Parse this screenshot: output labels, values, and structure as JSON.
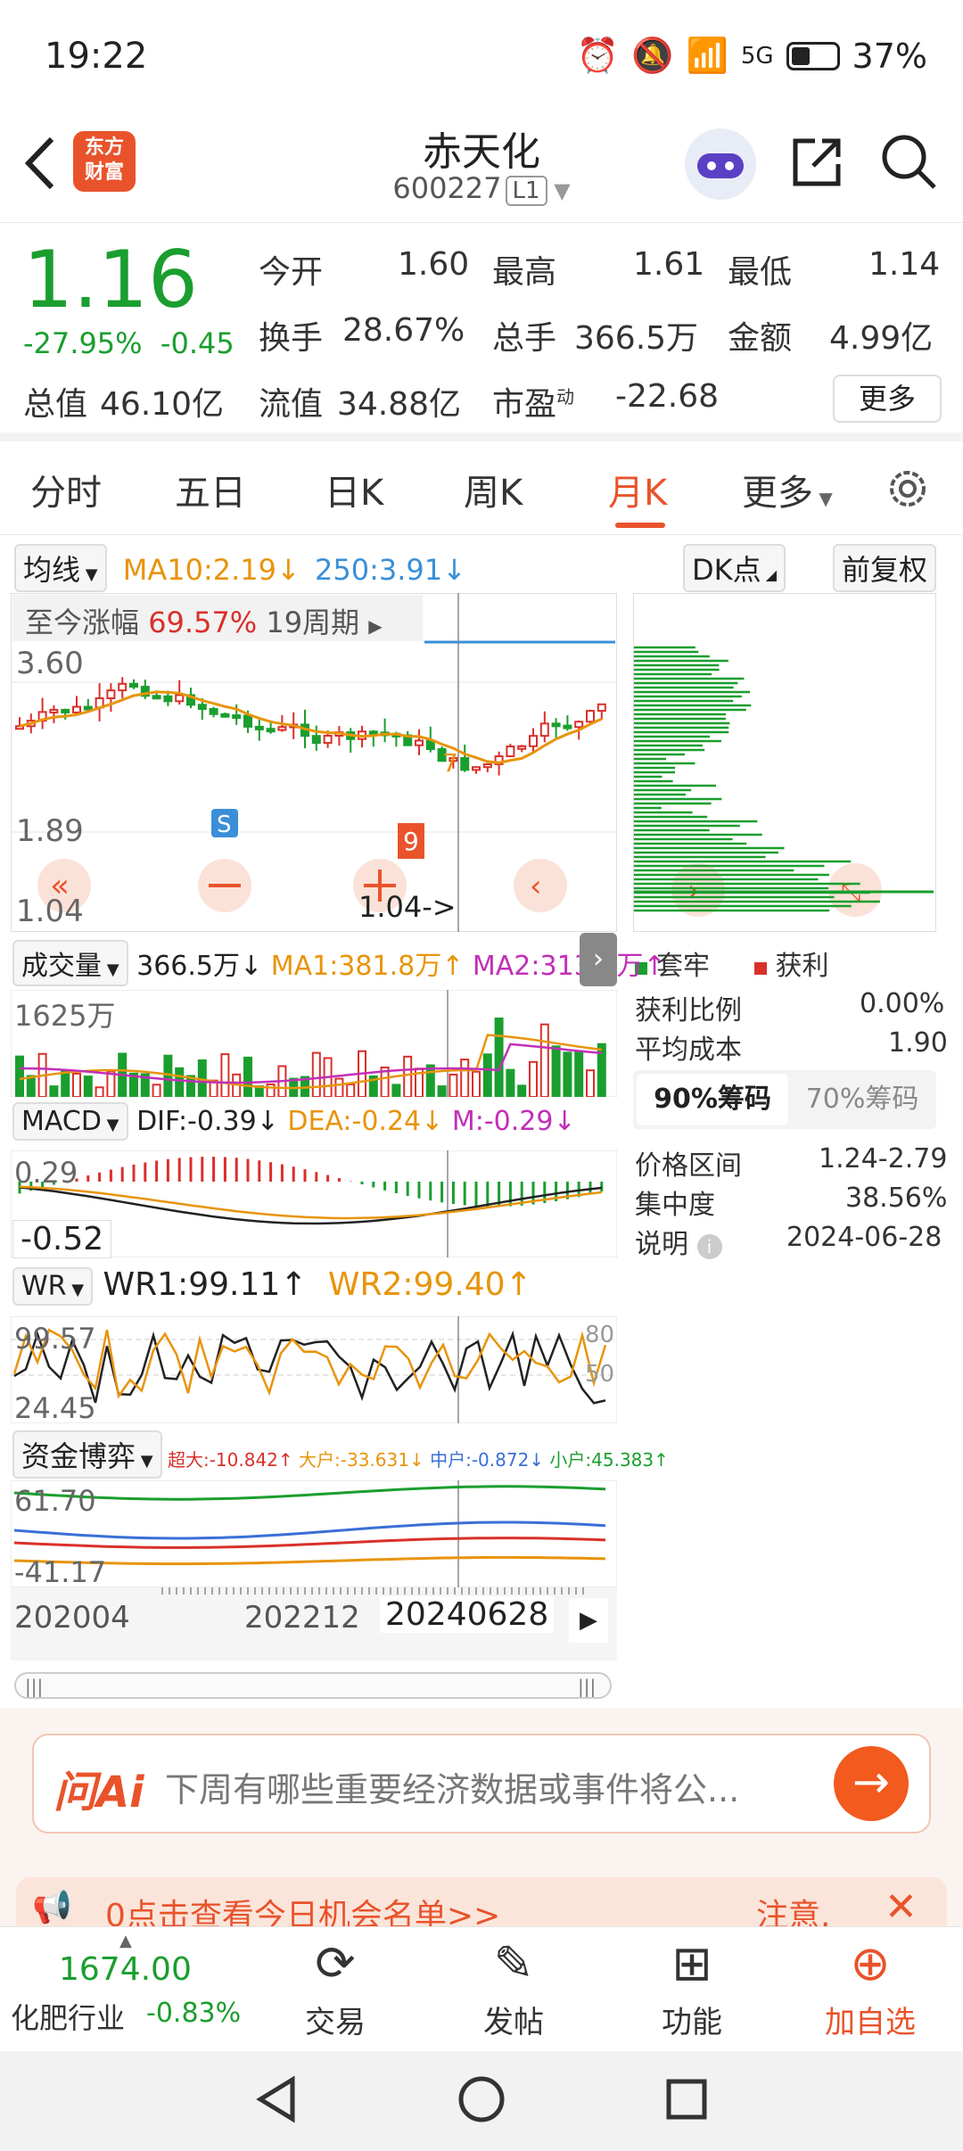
{
  "status": {
    "time": "19:22",
    "battery": "37%",
    "network": "5G"
  },
  "header": {
    "logo": "东方财富",
    "title": "赤天化",
    "code": "600227",
    "level": "L1"
  },
  "quote": {
    "price": "1.16",
    "pct": "-27.95%",
    "chg": "-0.45",
    "open_label": "今开",
    "open": "1.60",
    "high_label": "最高",
    "high": "1.61",
    "low_label": "最低",
    "low": "1.14",
    "turnover_label": "换手",
    "turnover": "28.67%",
    "volume_label": "总手",
    "volume": "366.5万",
    "amount_label": "金额",
    "amount": "4.99亿",
    "mktcap_label": "总值",
    "mktcap": "46.10亿",
    "float_label": "流值",
    "float": "34.88亿",
    "pe_label": "市盈",
    "pe_sup": "动",
    "pe": "-22.68",
    "more": "更多"
  },
  "tabs": [
    "分时",
    "五日",
    "日K",
    "周K",
    "月K",
    "更多"
  ],
  "active_tab": "月K",
  "ma": {
    "label": "均线",
    "ma10": "MA10:2.19↓",
    "ma250": "250:3.91↓",
    "dk": "DK点",
    "adjust": "前复权"
  },
  "main_chart": {
    "since": "至今涨幅",
    "since_pct": "69.57%",
    "periods": "19周期",
    "y_top": "3.60",
    "y_mid": "1.89",
    "y_bottom": "1.04",
    "low_marker": "1.04->",
    "signal_s": "S",
    "signal_nine": "9",
    "signal_seven": "7"
  },
  "volume": {
    "label": "成交量",
    "value": "366.5万↓",
    "ma1": "MA1:381.8万↑",
    "ma2": "MA2:313.2万↑",
    "y_top": "1625万"
  },
  "macd": {
    "label": "MACD",
    "dif": "DIF:-0.39↓",
    "dea": "DEA:-0.24↓",
    "m": "M:-0.29↓",
    "y_top": "0.29",
    "y_bottom": "-0.52"
  },
  "wr": {
    "label": "WR",
    "wr1": "WR1:99.11↑",
    "wr2": "WR2:99.40↑",
    "y_top": "99.57",
    "y_bottom": "24.45",
    "r80": "80",
    "r50": "50"
  },
  "fund": {
    "label": "资金博弈",
    "super": "超大:-10.842↑",
    "big": "大户:-33.631↓",
    "mid": "中户:-0.872↓",
    "small": "小户:45.383↑",
    "y_top": "61.70",
    "y_bottom": "-41.17"
  },
  "x_axis": {
    "start": "202004",
    "mid": "202212",
    "cursor": "20240628"
  },
  "chips": {
    "legend_trapped": "套牢",
    "legend_profit": "获利",
    "profit_ratio_label": "获利比例",
    "profit_ratio": "0.00%",
    "avg_cost_label": "平均成本",
    "avg_cost": "1.90",
    "seg_on": "90%筹码",
    "seg_off": "70%筹码",
    "range_label": "价格区间",
    "range": "1.24-2.79",
    "conc_label": "集中度",
    "conc": "38.56%",
    "desc_label": "说明",
    "desc": "2024-06-28"
  },
  "ai": {
    "logo": "问Ai",
    "placeholder": "下周有哪些重要经济数据或事件将公..."
  },
  "notice": {
    "text": "0点击查看今日机会名单>>",
    "right": "注意."
  },
  "bottom": {
    "index_value": "1674.00",
    "index_name": "化肥行业",
    "index_pct": "-0.83%",
    "trade": "交易",
    "post": "发帖",
    "func": "功能",
    "add": "加自选"
  },
  "colors": {
    "accent": "#e9532b",
    "down": "#1a9e2e",
    "up": "#d9302a"
  }
}
